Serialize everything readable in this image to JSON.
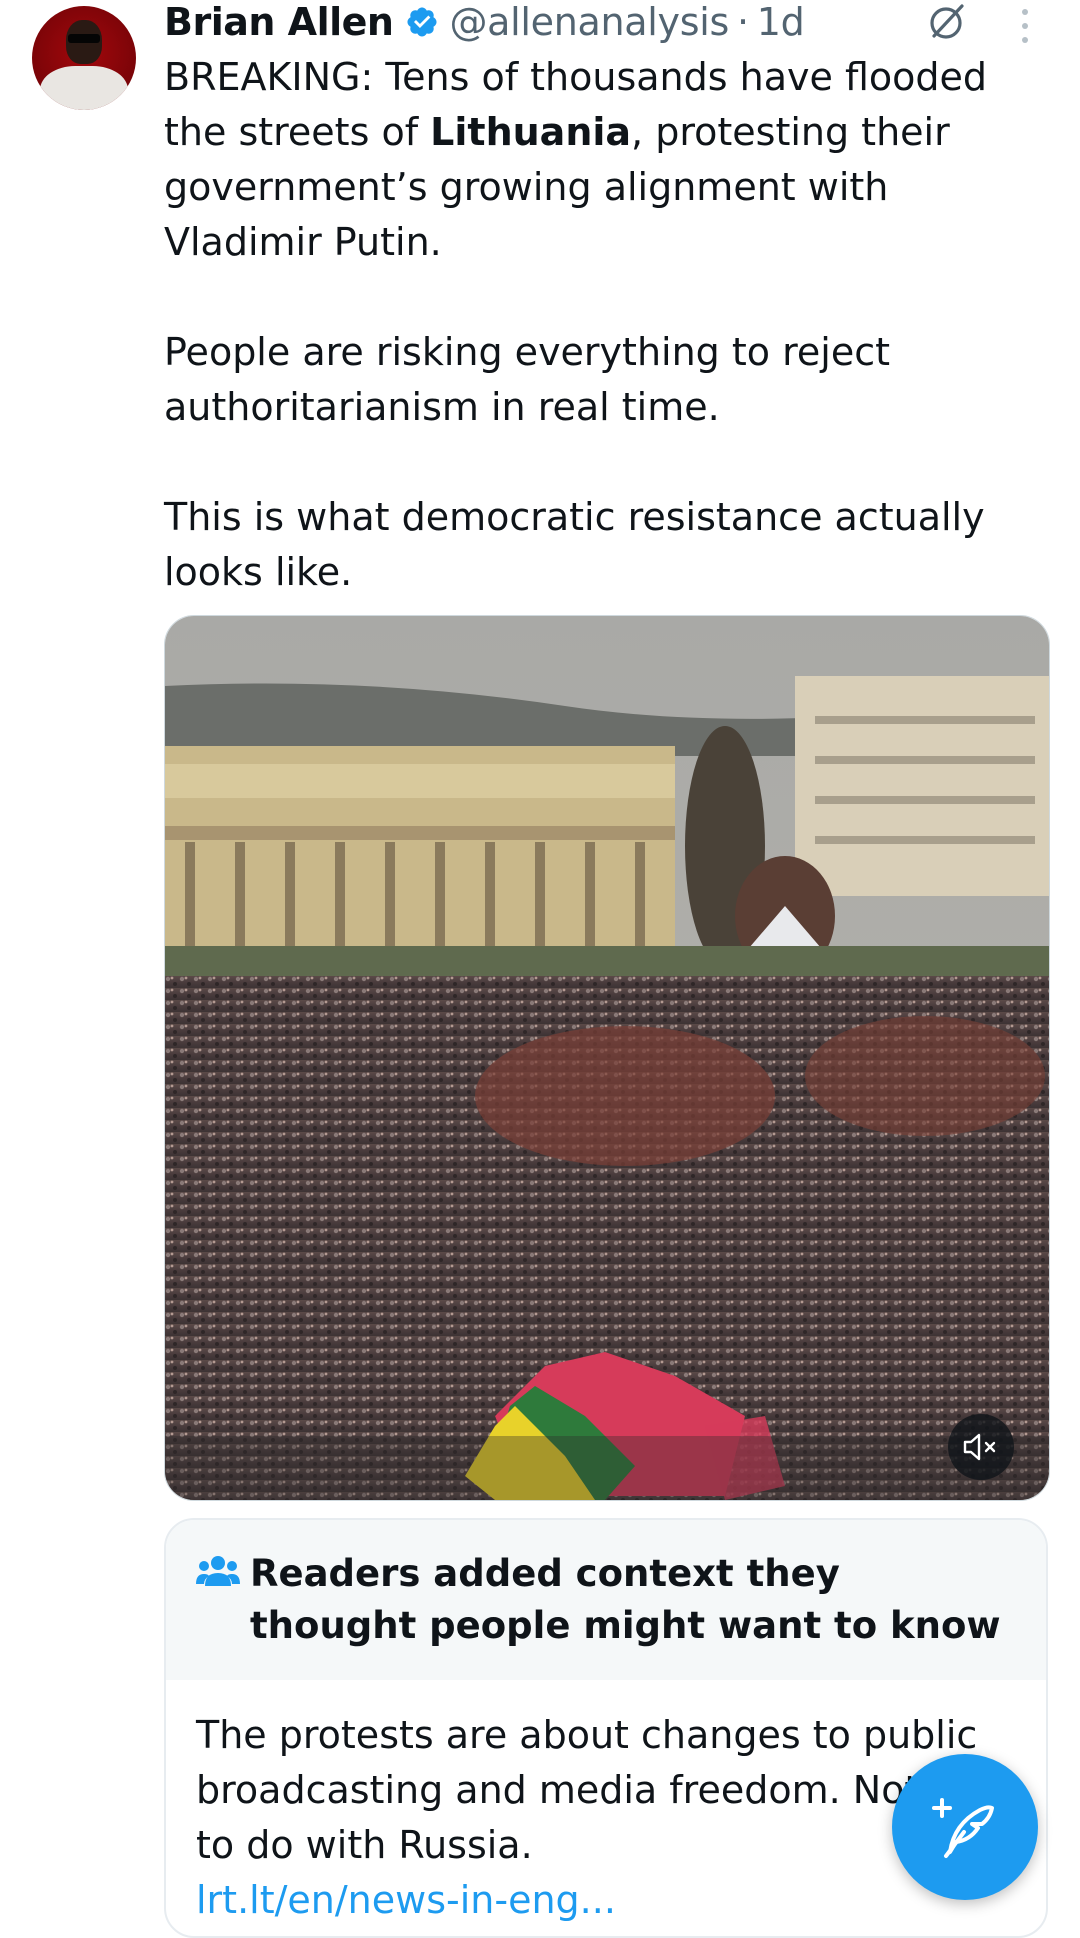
{
  "tweet": {
    "author_name": "Brian Allen",
    "handle": "@allenanalysis",
    "separator": "·",
    "time": "1d",
    "text_part1": "BREAKING: Tens of thousands have flooded the streets of ",
    "text_bold": "Lithuania",
    "text_part2": ", protesting their government’s growing alignment with Vladimir Putin.",
    "paragraph2": "People are risking everything to reject authoritarianism in real time.",
    "paragraph3": "This is what democratic resistance actually looks like."
  },
  "community_note": {
    "title": "Readers added context they thought people might want to know",
    "body": "The protests are about changes to public broadcasting and media freedom. Nothing to do with Russia.",
    "link": "lrt.lt/en/news-in-eng..."
  },
  "icons": {
    "verified": "verified-badge-icon",
    "grok": "grok-icon",
    "more": "more-vertical-icon",
    "mute": "speaker-muted-icon",
    "people": "people-icon",
    "compose": "compose-feather-icon"
  },
  "colors": {
    "accent": "#1d9bf0",
    "text": "#0f1419",
    "secondary": "#536471",
    "note_header_bg": "#f5f8f9"
  }
}
